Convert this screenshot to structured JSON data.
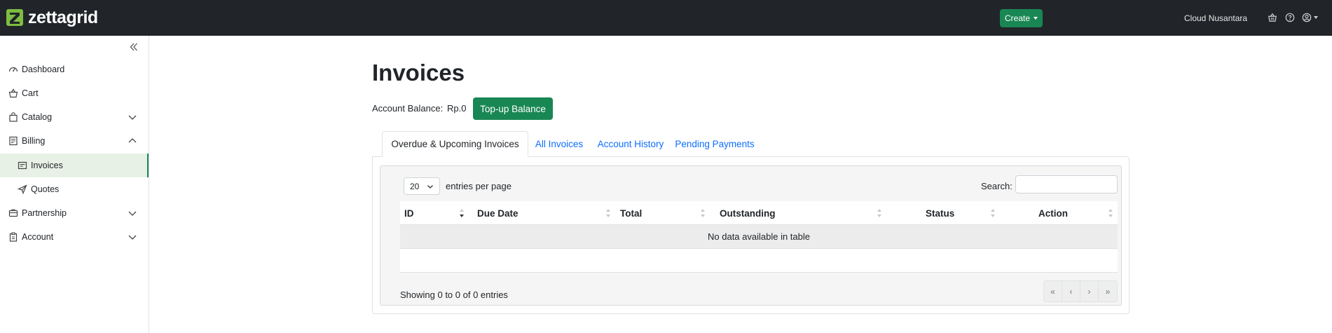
{
  "brand": {
    "name": "zettagrid",
    "color": "#7dbd41"
  },
  "header": {
    "create_label": "Create",
    "user_name": "Cloud Nusantara",
    "icons": [
      "basket-icon",
      "help-icon",
      "user-circle-icon"
    ]
  },
  "sidebar": {
    "items": [
      {
        "label": "Dashboard",
        "icon": "dashboard-icon"
      },
      {
        "label": "Cart",
        "icon": "basket-icon"
      },
      {
        "label": "Catalog",
        "icon": "bag-icon",
        "expandable": true,
        "expanded": false
      },
      {
        "label": "Billing",
        "icon": "receipt-icon",
        "expandable": true,
        "expanded": true
      },
      {
        "label": "Invoices",
        "icon": "invoice-icon",
        "active": true
      },
      {
        "label": "Quotes",
        "icon": "send-icon"
      },
      {
        "label": "Partnership",
        "icon": "partner-icon",
        "expandable": true,
        "expanded": false
      },
      {
        "label": "Account",
        "icon": "clipboard-icon",
        "expandable": true,
        "expanded": false
      }
    ]
  },
  "main": {
    "title": "Invoices",
    "balance_label": "Account Balance:",
    "balance_value": "Rp.0",
    "topup_label": "Top-up Balance",
    "tabs": [
      {
        "label": "Overdue & Upcoming Invoices",
        "active": true
      },
      {
        "label": "All Invoices"
      },
      {
        "label": "Account History"
      },
      {
        "label": "Pending Payments"
      }
    ],
    "table": {
      "page_length": "20",
      "page_length_label": "entries per page",
      "search_label": "Search:",
      "search_value": "",
      "columns": [
        "ID",
        "Due Date",
        "Total",
        "Outstanding",
        "Status",
        "Action"
      ],
      "empty_message": "No data available in table",
      "info": "Showing 0 to 0 of 0 entries",
      "pager": [
        "«",
        "‹",
        "›",
        "»"
      ]
    }
  },
  "colors": {
    "topbar": "#212529",
    "primary_green": "#198754",
    "link": "#0d6efd",
    "active_bg": "#e8f1e6"
  }
}
